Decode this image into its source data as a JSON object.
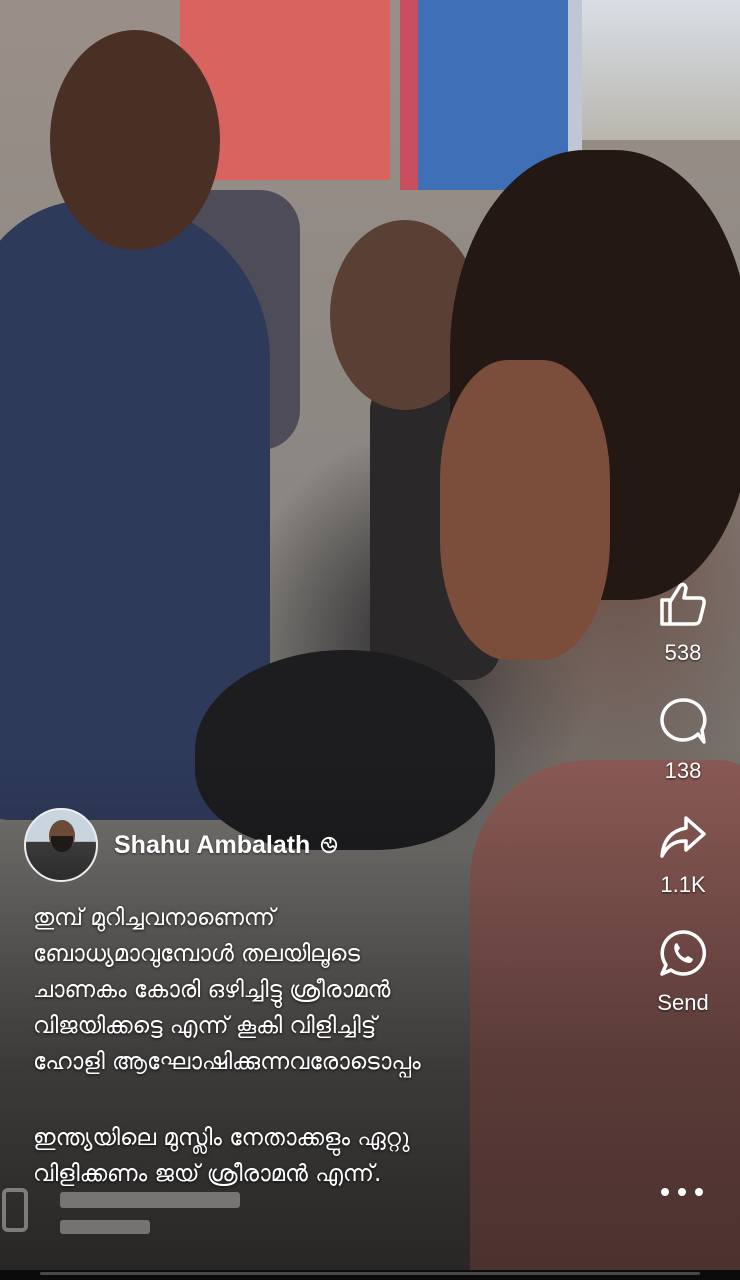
{
  "post": {
    "author": "Shahu Ambalath",
    "visibility_icon": "globe-icon",
    "caption_lines": [
      "തുമ്പ് മുറിച്ചവനാണെന്ന്",
      "ബോധ്യമാവുമ്പോൾ തലയിലൂടെ",
      "ചാണകം കോരി ഒഴിച്ചിട്ടു ശ്രീരാമൻ",
      "വിജയിക്കട്ടെ എന്ന് കൂകി വിളിച്ചിട്ട്",
      "ഹോളി ആഘോഷിക്കുന്നവരോടൊപ്പം"
    ],
    "caption_lines_2": [
      "ഇന്ത്യയിലെ മുസ്ലിം നേതാക്കളും ഏറ്റു",
      "വിളിക്കണം ജയ് ശ്രീരാമൻ എന്ന്."
    ]
  },
  "actions": {
    "like_count": "538",
    "comment_count": "138",
    "share_count": "1.1K",
    "send_label": "Send",
    "more_icon": "more-horizontal-icon"
  },
  "video": {
    "progress": 0.0
  }
}
